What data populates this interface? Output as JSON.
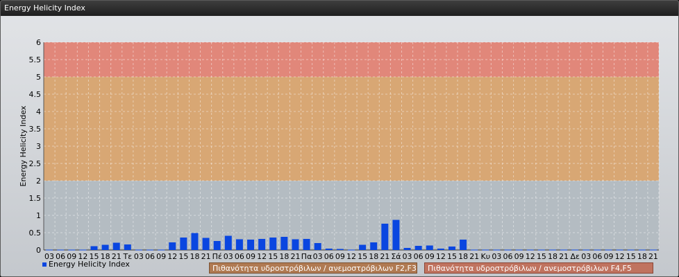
{
  "window": {
    "title": "Energy Helicity Index"
  },
  "colors": {
    "bar": "#0a46e0",
    "band_green": "#b4bcc2",
    "band_orange": "#d8a774",
    "band_red": "#e1877a"
  },
  "chart_data": {
    "type": "bar",
    "title": "",
    "ylabel": "Energy Helicity Index",
    "xlabel": "",
    "ylim": [
      0,
      6
    ],
    "yticks": [
      "0",
      "0.5",
      "1",
      "1.5",
      "2",
      "2.5",
      "3",
      "3.5",
      "4",
      "4.5",
      "5",
      "5.5",
      "6"
    ],
    "grid": true,
    "categories": [
      "03",
      "06",
      "09",
      "12",
      "15",
      "18",
      "21",
      "Τε",
      "03",
      "06",
      "09",
      "12",
      "15",
      "18",
      "21",
      "Πέ",
      "03",
      "06",
      "09",
      "12",
      "15",
      "18",
      "21",
      "Πα",
      "03",
      "06",
      "09",
      "12",
      "15",
      "18",
      "21",
      "Σά",
      "03",
      "06",
      "09",
      "12",
      "15",
      "18",
      "21",
      "Κυ",
      "03",
      "06",
      "09",
      "12",
      "15",
      "18",
      "21",
      "Δε",
      "03",
      "06",
      "09",
      "12",
      "15",
      "18",
      "21"
    ],
    "series": [
      {
        "name": "Energy Helicity Index",
        "values": [
          0.01,
          0.01,
          0.01,
          0.01,
          0.11,
          0.15,
          0.21,
          0.16,
          0.01,
          0.01,
          0.01,
          0.22,
          0.36,
          0.49,
          0.35,
          0.26,
          0.41,
          0.31,
          0.3,
          0.32,
          0.36,
          0.38,
          0.31,
          0.32,
          0.2,
          0.04,
          0.03,
          0.01,
          0.15,
          0.22,
          0.76,
          0.87,
          0.06,
          0.12,
          0.13,
          0.04,
          0.1,
          0.3,
          0.01,
          0.01,
          0.01,
          0.01,
          0.01,
          0.01,
          0.01,
          0.01,
          0.01,
          0.01,
          0.01,
          0.01,
          0.01,
          0.01,
          0.01,
          0.01,
          0.01
        ]
      }
    ],
    "bands": [
      {
        "from": 2,
        "to": 5,
        "label": "Πιθανότητα υδροστρόβιλων / ανεμοστρόβιλων F2,F3",
        "color": "#d8a774"
      },
      {
        "from": 5,
        "to": 6,
        "label": "Πιθανότητα υδροστρόβιλων / ανεμοστρόβιλων F4,F5",
        "color": "#e1877a"
      }
    ],
    "legend_position": "bottom"
  }
}
